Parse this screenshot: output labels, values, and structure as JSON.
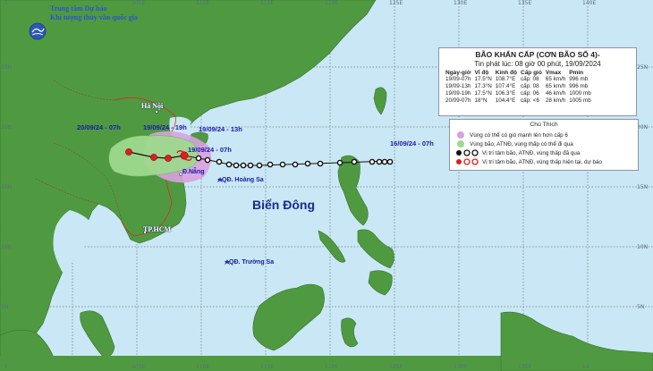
{
  "agency": {
    "line1": "Trung tâm Dự báo",
    "line2": "Khí tượng thủy văn quốc gia"
  },
  "bulletin": {
    "title": "BÃO KHẨN CẤP (CƠN BÃO SỐ 4)-",
    "issued": "Tin phát lúc: 08 giờ 00 phút, 19/09/2024",
    "headers": [
      "Ngày-giờ",
      "Vĩ độ",
      "Kinh độ",
      "Cấp gió",
      "Vmax",
      "Pmin"
    ],
    "rows": [
      [
        "19/09-07h",
        "17.5°N",
        "108.7°E",
        "cấp: 08",
        "65 km/h",
        "996 mb"
      ],
      [
        "19/09-13h",
        "17.3°N",
        "107.4°E",
        "cấp: 08",
        "65 km/h",
        "996 mb"
      ],
      [
        "19/09-19h",
        "17.5°N",
        "106.3°E",
        "cấp: 06",
        "46 km/h",
        "1000 mb"
      ],
      [
        "20/09-07h",
        "18°N",
        "104.4°E",
        "cấp: <6",
        "28 km/h",
        "1005 mb"
      ]
    ]
  },
  "legend": {
    "title": "Chú Thích",
    "items": [
      "Vùng có thể có gió mạnh lên hơn cấp 6",
      "Vùng bão, ATNĐ, vùng thấp có thể đi qua",
      "Vị trí tâm bão, ATNĐ, vùng thấp đã qua",
      "Vị trí tâm bão, ATNĐ, vùng thấp hiện tại, dự báo"
    ]
  },
  "places": {
    "hanoi": "Hà Nội",
    "danang": "Đ.Nẵng",
    "tphcm": "TP.HCM",
    "hoangsa": "QĐ. Hoàng Sa",
    "truongsa": "QĐ. Trường Sa",
    "sea": "Biển Đông"
  },
  "track_labels": {
    "t20_07": "20/09/24 - 07h",
    "t19_19": "19/09/24 - 19h",
    "t19_13": "19/09/24 - 13h",
    "t19_07": "19/09/24 - 07h",
    "t16_07": "16/09/24 - 07h"
  },
  "axes": {
    "top_lon": [
      "E",
      "105E",
      "110E",
      "115E",
      "120E",
      "125E",
      "130E",
      "135E",
      "140E"
    ],
    "bottom_lon": [
      "E",
      "105E",
      "110E",
      "115E",
      "120E",
      "125E",
      "130E",
      "135E",
      "14"
    ],
    "left_lat": [
      "25N",
      "20N",
      "15N",
      "10N",
      "5N"
    ],
    "right_lat": [
      "25N",
      "20N",
      "15N",
      "10N",
      "5N"
    ]
  },
  "colors": {
    "ocean": "#c9e7f4",
    "land": "#4f9a40",
    "danger_zone": "#d9a1e0",
    "forecast_cone": "#9ed98e",
    "past_track": "#000000",
    "forecast_center": "#e11d1d"
  }
}
